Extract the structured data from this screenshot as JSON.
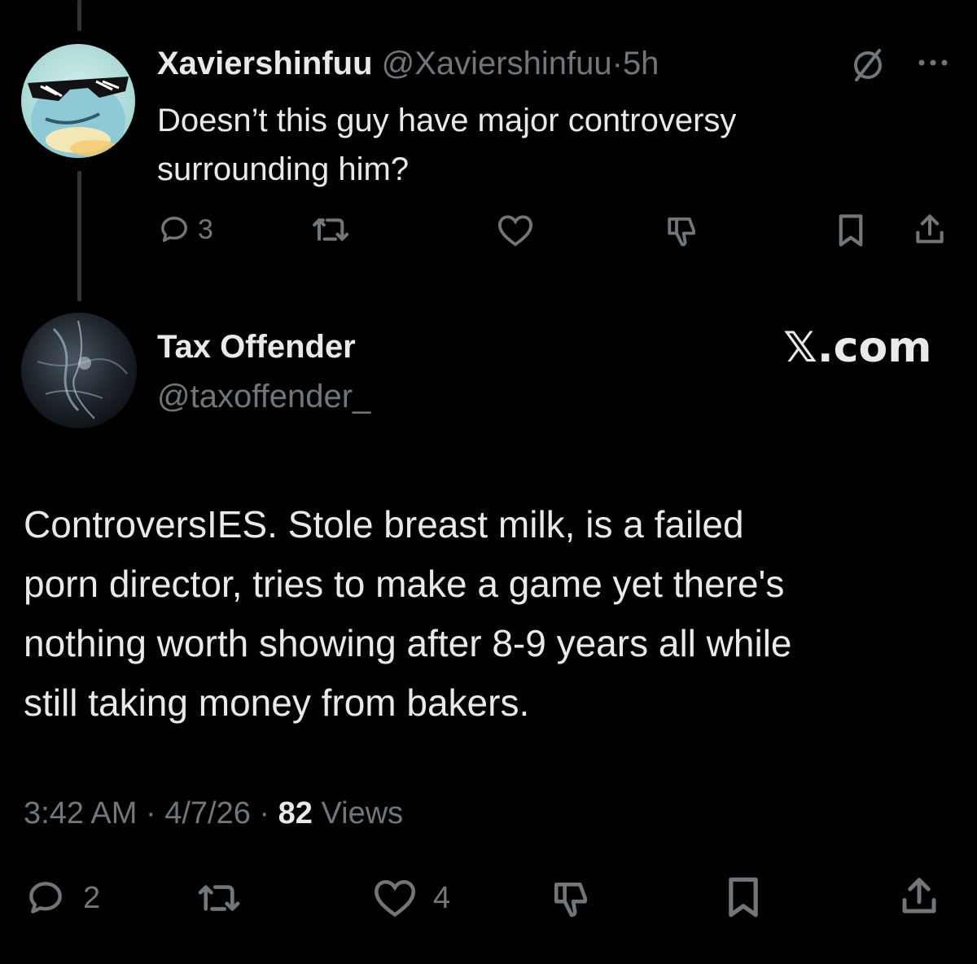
{
  "reply": {
    "display_name": "Xaviershinfuu",
    "handle": "@Xaviershinfuu",
    "separator": "·",
    "time": "5h",
    "text_line1": "Doesn’t this guy have major controversy",
    "text_line2": "surrounding him?",
    "actions": {
      "reply_count": "3",
      "repost_count": "",
      "like_count": ""
    },
    "icons": [
      "grok-icon",
      "more-icon",
      "reply-icon",
      "repost-icon",
      "like-icon",
      "dislike-icon",
      "bookmark-icon",
      "share-icon"
    ]
  },
  "main_tweet": {
    "display_name": "Tax Offender",
    "handle": "@taxoffender_",
    "watermark": "𝕏.com",
    "text_line1": "ControversIES. Stole breast milk, is a failed",
    "text_line2": "porn director, tries to make a game yet there's",
    "text_line3": "nothing worth showing after 8-9 years all while",
    "text_line4": "still taking money from bakers.",
    "meta": {
      "time": "3:42 AM",
      "sep1": "·",
      "date": "4/7/26",
      "sep2": "·",
      "views_count": "82",
      "views_label": "Views"
    },
    "actions": {
      "reply_count": "2",
      "repost_count": "",
      "like_count": "4"
    }
  },
  "colors": {
    "background": "#000000",
    "text": "#e7e9ea",
    "muted": "#71767b",
    "thread_line": "#333639"
  }
}
